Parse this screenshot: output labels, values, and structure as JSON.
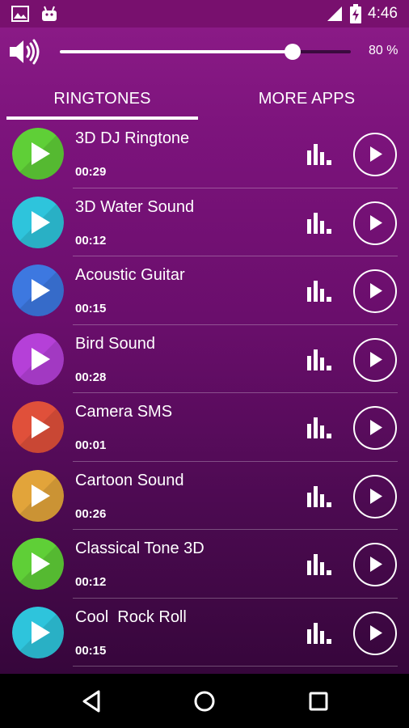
{
  "status_bar": {
    "time": "4:46",
    "icons": [
      "image-icon",
      "android-icon",
      "signal-icon",
      "battery-icon"
    ]
  },
  "volume": {
    "icon": "speaker-icon",
    "level_fraction": 0.8,
    "percent_label": "80 %"
  },
  "tabs": [
    {
      "label": "RINGTONES",
      "active": true
    },
    {
      "label": "MORE APPS",
      "active": false
    }
  ],
  "ringtones": [
    {
      "title": "3D DJ Ringtone",
      "duration": "00:29",
      "color": "#5fcf37"
    },
    {
      "title": "3D Water Sound",
      "duration": "00:12",
      "color": "#2ec4dc"
    },
    {
      "title": "Acoustic Guitar",
      "duration": "00:15",
      "color": "#3d78e0"
    },
    {
      "title": "Bird Sound",
      "duration": "00:28",
      "color": "#b540d8"
    },
    {
      "title": "Camera SMS",
      "duration": "00:01",
      "color": "#e0503a"
    },
    {
      "title": "Cartoon Sound",
      "duration": "00:26",
      "color": "#e2a43a"
    },
    {
      "title": "Classical Tone 3D",
      "duration": "00:12",
      "color": "#5fcf37"
    },
    {
      "title": "Cool  Rock Roll",
      "duration": "00:15",
      "color": "#2ec4dc"
    }
  ],
  "nav_bar": {
    "icons": [
      "back-icon",
      "home-icon",
      "recents-icon"
    ]
  }
}
